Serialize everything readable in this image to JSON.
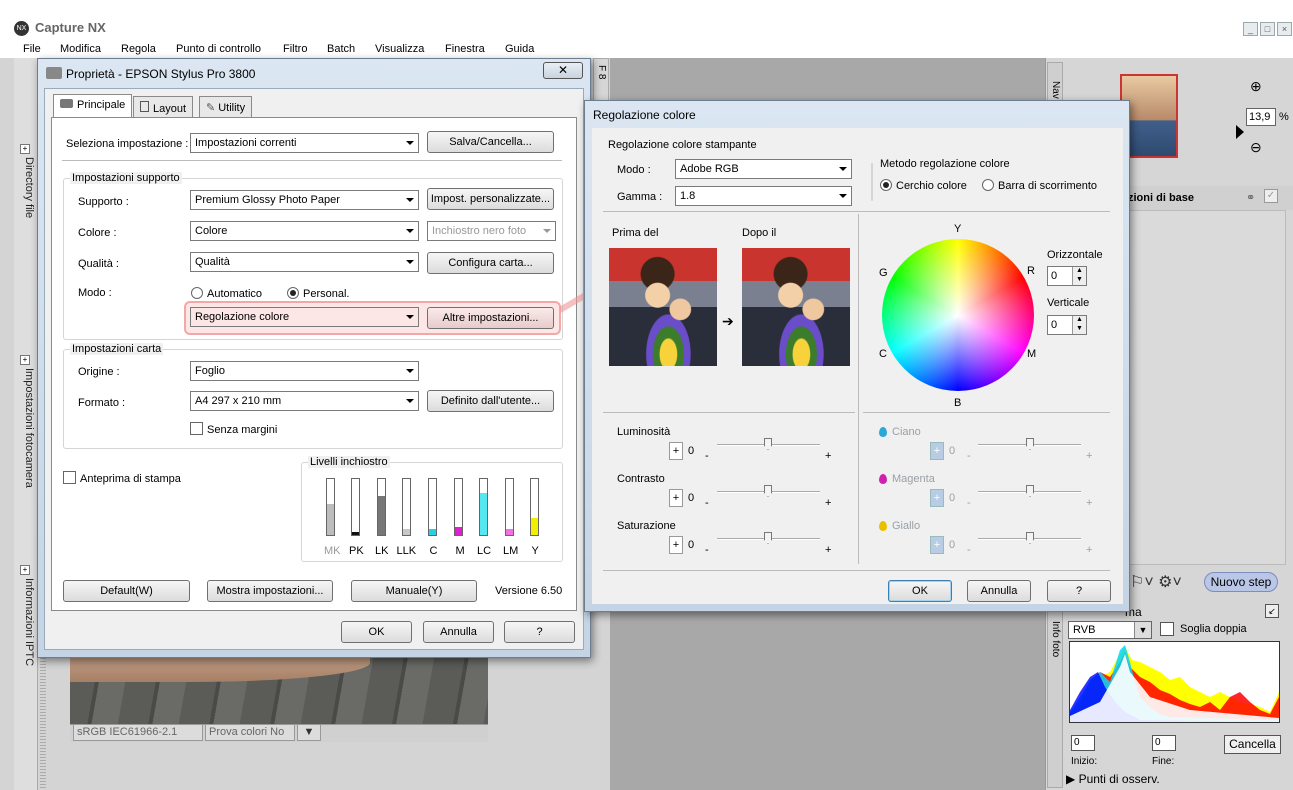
{
  "app": {
    "title": "Capture NX",
    "menu": [
      "File",
      "Modifica",
      "Regola",
      "Punto di controllo",
      "Filtro",
      "Batch",
      "Visualizza",
      "Finestra",
      "Guida"
    ],
    "window_controls": [
      "_",
      "□",
      "×"
    ]
  },
  "left_panel": {
    "tabs": [
      "Directory file",
      "Impostazioni fotocamera",
      "Informazioni IPTC"
    ]
  },
  "photo_status": {
    "profile": "sRGB IEC61966-2.1",
    "proof": "Prova colori No"
  },
  "mid_strip_label": "F 8",
  "right_panel": {
    "nav_label": "Nav",
    "zoom_value": "13,9",
    "zoom_unit": "%",
    "basic_title": "zioni di base",
    "new_step": "Nuovo step",
    "histogram_title": "ma",
    "info_label": "Info foto",
    "channel": "RVB",
    "dual_threshold": "Soglia doppia",
    "start_value": "0",
    "end_value": "0",
    "start_label": "Inizio:",
    "end_label": "Fine:",
    "cancel": "Cancella",
    "watch_points": "▶ Punti di osserv."
  },
  "properties_dialog": {
    "title": "Proprietà - EPSON Stylus Pro 3800",
    "close": "✕",
    "tabs": [
      "Principale",
      "Layout",
      "Utility"
    ],
    "select_setting_label": "Seleziona impostazione :",
    "select_setting_value": "Impostazioni correnti",
    "save_cancel": "Salva/Cancella...",
    "media_group": "Impostazioni supporto",
    "media_label": "Supporto :",
    "media_value": "Premium Glossy Photo Paper",
    "custom_settings": "Impost. personalizzate...",
    "color_label": "Colore :",
    "color_value": "Colore",
    "black_ink_value": "Inchiostro nero foto",
    "quality_label": "Qualità :",
    "quality_value": "Qualità",
    "paper_config": "Configura carta...",
    "mode_label": "Modo :",
    "mode_auto": "Automatico",
    "mode_custom": "Personal.",
    "mode_custom_value": "Regolazione colore",
    "other_settings": "Altre impostazioni...",
    "paper_group": "Impostazioni carta",
    "source_label": "Origine :",
    "source_value": "Foglio",
    "format_label": "Formato :",
    "format_value": "A4 297 x 210 mm",
    "user_defined": "Definito dall'utente...",
    "borderless": "Senza margini",
    "print_preview": "Anteprima di stampa",
    "ink_levels_title": "Livelli inchiostro",
    "inks": [
      {
        "name": "MK",
        "level": 0.55,
        "color": "#bdbdbd"
      },
      {
        "name": "PK",
        "level": 0.05,
        "color": "#111111"
      },
      {
        "name": "LK",
        "level": 0.7,
        "color": "#777777"
      },
      {
        "name": "LLK",
        "level": 0.1,
        "color": "#c8c8c8"
      },
      {
        "name": "C",
        "level": 0.1,
        "color": "#22d3e8"
      },
      {
        "name": "M",
        "level": 0.15,
        "color": "#e020d0"
      },
      {
        "name": "LC",
        "level": 0.75,
        "color": "#55e8f0"
      },
      {
        "name": "LM",
        "level": 0.1,
        "color": "#f070e8"
      },
      {
        "name": "Y",
        "level": 0.3,
        "color": "#f0f000"
      }
    ],
    "default_btn": "Default(W)",
    "show_settings": "Mostra impostazioni...",
    "manual": "Manuale(Y)",
    "version": "Versione 6.50",
    "ok": "OK",
    "cancel": "Annulla",
    "help": "?"
  },
  "color_dialog": {
    "title": "Regolazione colore",
    "printer_group": "Regolazione colore stampante",
    "mode_label": "Modo :",
    "mode_value": "Adobe RGB",
    "gamma_label": "Gamma :",
    "gamma_value": "1.8",
    "method_group": "Metodo regolazione colore",
    "method_circle": "Cerchio colore",
    "method_slider": "Barra di scorrimento",
    "before_label": "Prima del",
    "after_label": "Dopo il",
    "wheel_labels": {
      "Y": "Y",
      "R": "R",
      "M": "M",
      "B": "B",
      "C": "C",
      "G": "G"
    },
    "horizontal_label": "Orizzontale",
    "horizontal_value": "0",
    "vertical_label": "Verticale",
    "vertical_value": "0",
    "sliders": [
      {
        "label": "Luminosità",
        "sign": "+",
        "value": "0",
        "min": "-",
        "max": "+"
      },
      {
        "label": "Contrasto",
        "sign": "+",
        "value": "0",
        "min": "-",
        "max": "+"
      },
      {
        "label": "Saturazione",
        "sign": "+",
        "value": "0",
        "min": "-",
        "max": "+"
      }
    ],
    "color_sliders": [
      {
        "label": "Ciano",
        "sign": "+",
        "value": "0",
        "min": "-",
        "max": "+",
        "color": "#2aa8d8"
      },
      {
        "label": "Magenta",
        "sign": "+",
        "value": "0",
        "min": "-",
        "max": "+",
        "color": "#d020b0"
      },
      {
        "label": "Giallo",
        "sign": "+",
        "value": "0",
        "min": "-",
        "max": "+",
        "color": "#e8c000"
      }
    ],
    "ok": "OK",
    "cancel": "Annulla",
    "help": "?"
  }
}
